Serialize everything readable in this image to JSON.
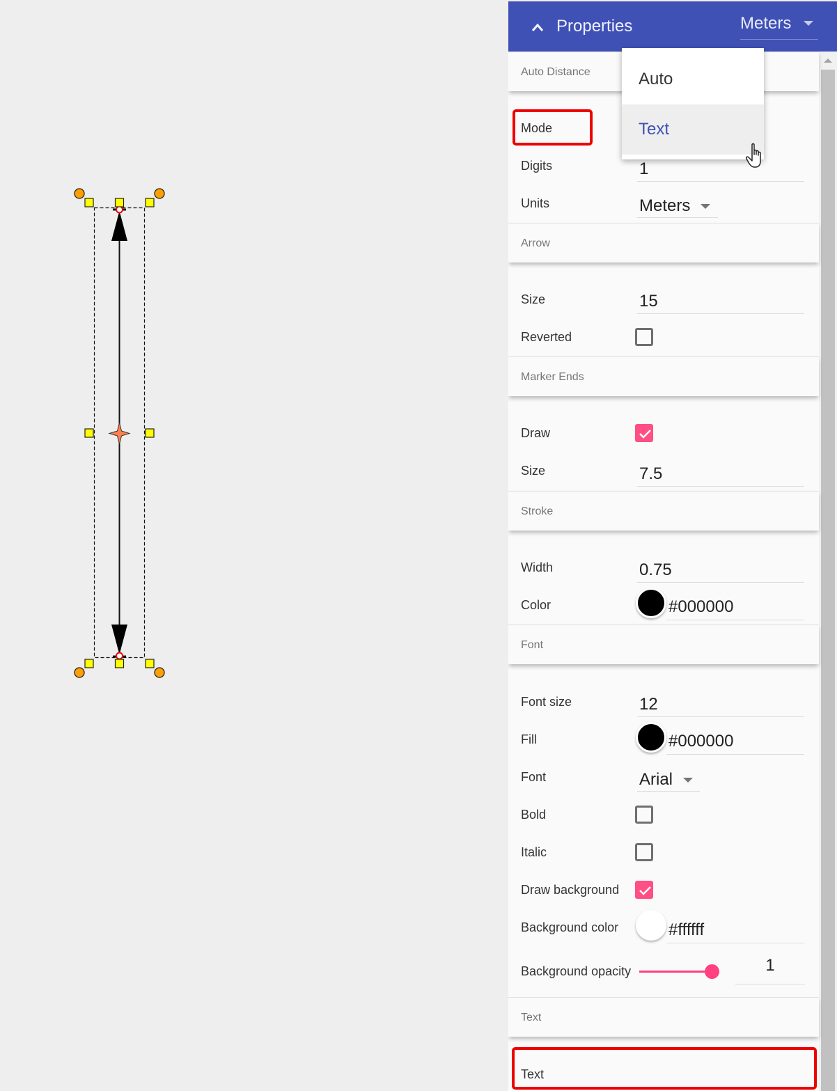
{
  "colors": {
    "header_bg": "#3f51b5",
    "accent_pink": "#ff4081",
    "highlight_red": "#ee0000",
    "selected_menu_text": "#3f51b5"
  },
  "canvas": {
    "shape": "dimension-arrow",
    "handles": {
      "rotate_handle_icon": "orange-circle",
      "resize_handle_icon": "yellow-square",
      "endpoint_icon": "red-ring",
      "center_icon": "orange-four-point-star"
    }
  },
  "header": {
    "collapse_icon": "chevron-up-icon",
    "title": "Properties",
    "units_value": "Meters"
  },
  "mode_menu": {
    "options": [
      {
        "label": "Auto",
        "selected": false
      },
      {
        "label": "Text",
        "selected": true
      }
    ],
    "cursor_icon": "hand-pointer-icon"
  },
  "sections": {
    "auto_distance": {
      "title": "Auto Distance",
      "mode_label": "Mode",
      "digits_label": "Digits",
      "digits_value": "1",
      "units_label": "Units",
      "units_value": "Meters"
    },
    "arrow": {
      "title": "Arrow",
      "size_label": "Size",
      "size_value": "15",
      "reverted_label": "Reverted",
      "reverted_checked": false
    },
    "marker_ends": {
      "title": "Marker Ends",
      "draw_label": "Draw",
      "draw_checked": true,
      "size_label": "Size",
      "size_value": "7.5"
    },
    "stroke": {
      "title": "Stroke",
      "width_label": "Width",
      "width_value": "0.75",
      "color_label": "Color",
      "color_value": "#000000"
    },
    "font": {
      "title": "Font",
      "font_size_label": "Font size",
      "font_size_value": "12",
      "fill_label": "Fill",
      "fill_value": "#000000",
      "font_label": "Font",
      "font_value": "Arial",
      "bold_label": "Bold",
      "bold_checked": false,
      "italic_label": "Italic",
      "italic_checked": false,
      "draw_background_label": "Draw background",
      "draw_background_checked": true,
      "background_color_label": "Background color",
      "background_color_value": "#ffffff",
      "background_opacity_label": "Background opacity",
      "background_opacity_value": "1",
      "background_opacity_fraction": 1.0
    },
    "text": {
      "title": "Text",
      "text_label": "Text"
    }
  }
}
